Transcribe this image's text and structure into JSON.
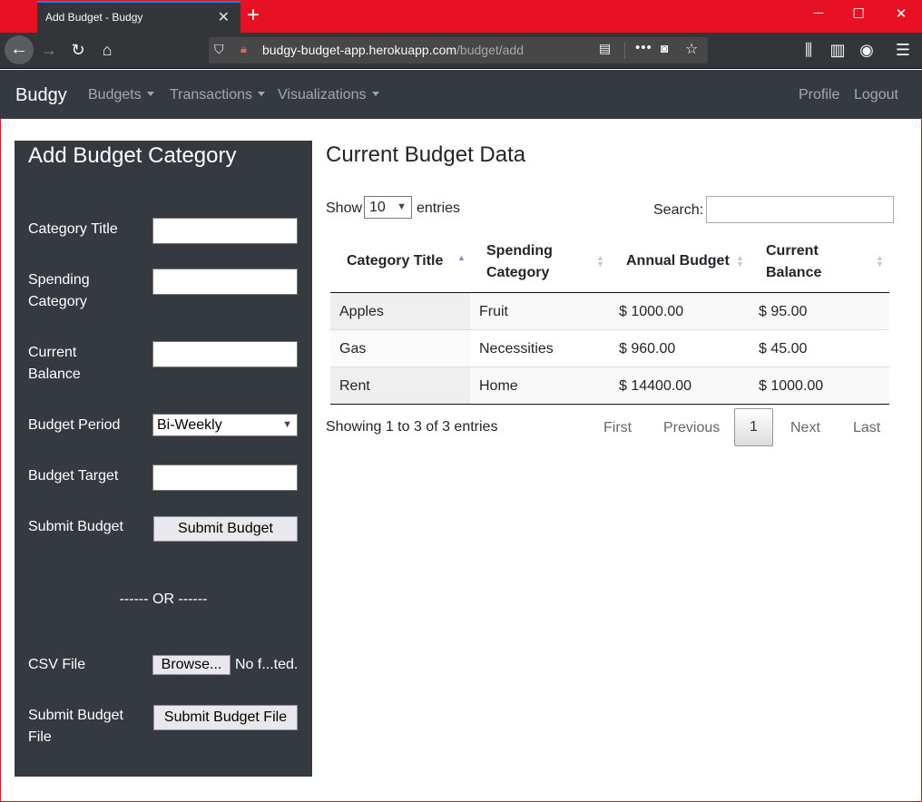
{
  "browser": {
    "tab_title": "Add Budget - Budgy",
    "url_domain": "budgy-budget-app.herokuapp.com",
    "url_path": "/budget/add"
  },
  "navbar": {
    "brand": "Budgy",
    "links": [
      "Budgets",
      "Transactions",
      "Visualizations"
    ],
    "right_links": [
      "Profile",
      "Logout"
    ]
  },
  "add_form": {
    "title": "Add Budget Category",
    "category_title_label": "Category Title",
    "spending_category_label": "Spending Category",
    "current_balance_label": "Current Balance",
    "budget_period_label": "Budget Period",
    "budget_period_value": "Bi-Weekly",
    "budget_target_label": "Budget Target",
    "submit_budget_label": "Submit Budget",
    "submit_budget_button": "Submit Budget",
    "or_divider": "------ OR ------",
    "csv_file_label": "CSV File",
    "browse_button": "Browse...",
    "file_status": "No f...ted.",
    "submit_file_label": "Submit Budget File",
    "submit_file_button": "Submit Budget File"
  },
  "data_table": {
    "title": "Current Budget Data",
    "show_label": "Show",
    "page_length": "10",
    "entries_label": "entries",
    "search_label": "Search:",
    "columns": [
      "Category Title",
      "Spending Category",
      "Annual Budget",
      "Current Balance"
    ],
    "rows": [
      [
        "Apples",
        "Fruit",
        "$ 1000.00",
        "$ 95.00"
      ],
      [
        "Gas",
        "Necessities",
        "$ 960.00",
        "$ 45.00"
      ],
      [
        "Rent",
        "Home",
        "$ 14400.00",
        "$ 1000.00"
      ]
    ],
    "info": "Showing 1 to 3 of 3 entries",
    "pagination": {
      "first": "First",
      "previous": "Previous",
      "current": "1",
      "next": "Next",
      "last": "Last"
    }
  }
}
